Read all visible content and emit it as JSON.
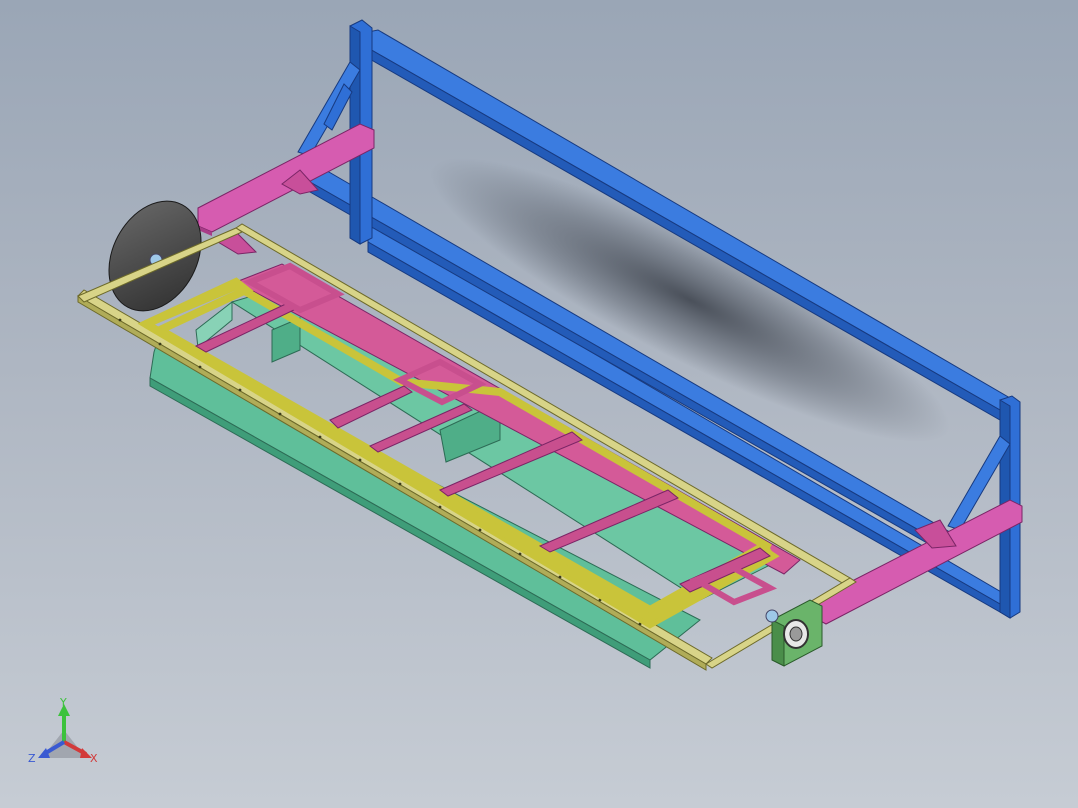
{
  "viewport": {
    "background_top": "#9aa6b6",
    "background_bottom": "#c6ccd4"
  },
  "model": {
    "colors": {
      "outer_frame": "#2f6fd6",
      "support_arm": "#cc4fa6",
      "cradle_rail": "#d2cf7a",
      "inner_flange": "#c9c43a",
      "tank": "#5fbf9a",
      "tank_side": "#88d2b6",
      "cross_member": "#c84f8e",
      "end_disc": "#4a4a4a",
      "bearing_plate": "#5aa05a"
    },
    "parts": [
      "outer-frame",
      "left-support-arm",
      "right-support-arm",
      "cradle-frame",
      "tank-body",
      "inner-frame",
      "end-disc",
      "bearing-block"
    ]
  },
  "triad": {
    "y_label": "Y",
    "x_label": "X",
    "z_label": "Z",
    "y_color": "#3cc23c",
    "x_color": "#d23a3a",
    "z_color": "#3a5ad2"
  }
}
